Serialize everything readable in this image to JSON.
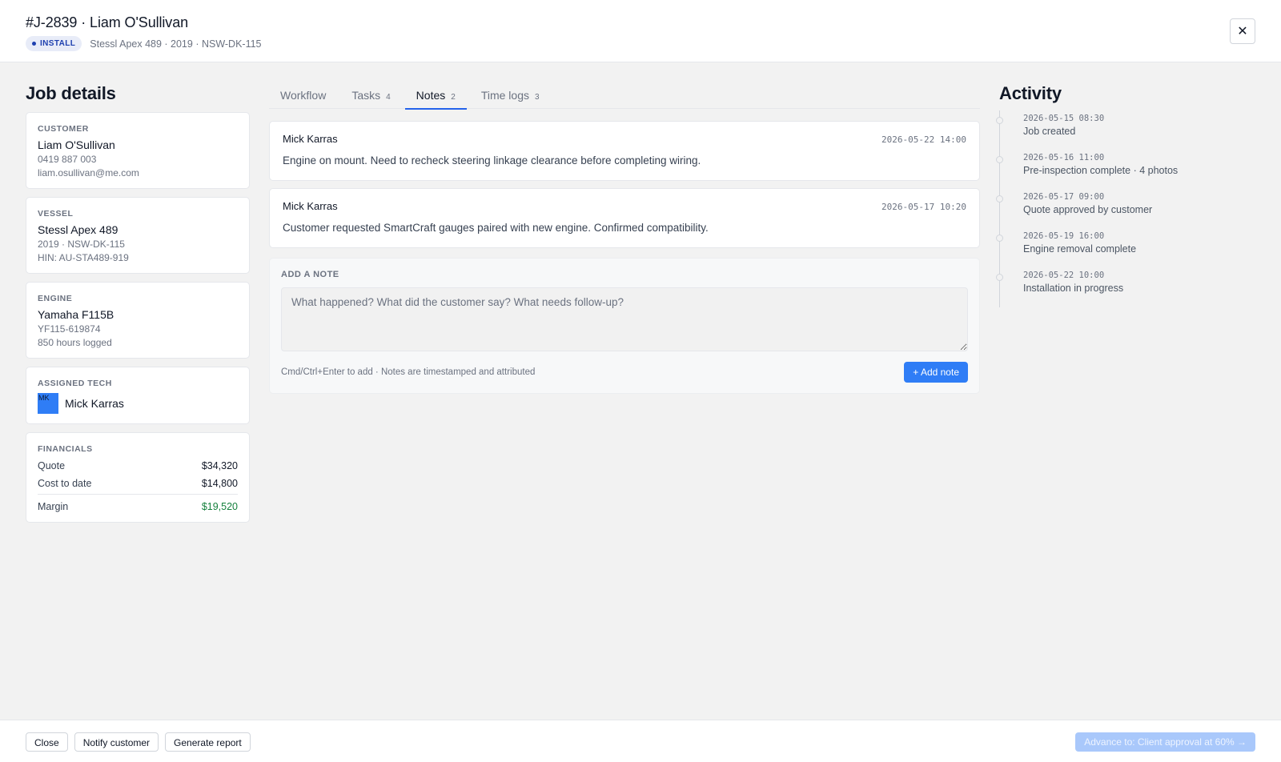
{
  "header": {
    "title": "#J-2839 · Liam O'Sullivan",
    "badge": "INSTALL",
    "meta": "Stessl Apex 489 · 2019 · NSW-DK-115",
    "close_icon": "✕"
  },
  "left": {
    "title": "Job details",
    "customer": {
      "label": "CUSTOMER",
      "name": "Liam O'Sullivan",
      "phone": "0419 887 003",
      "email": "liam.osullivan@me.com"
    },
    "vessel": {
      "label": "VESSEL",
      "name": "Stessl Apex 489",
      "detail": "2019 · NSW-DK-115",
      "hin": "HIN: AU-STA489-919"
    },
    "engine": {
      "label": "ENGINE",
      "name": "Yamaha F115B",
      "serial": "YF115-619874",
      "hours": "850 hours logged"
    },
    "tech": {
      "label": "ASSIGNED TECH",
      "initials": "MK",
      "name": "Mick Karras",
      "avatar_color": "#2f7df6"
    },
    "financials": {
      "label": "FINANCIALS",
      "quote_label": "Quote",
      "quote_value": "$34,320",
      "cost_label": "Cost to date",
      "cost_value": "$14,800",
      "margin_label": "Margin",
      "margin_value": "$19,520",
      "margin_color": "#15803d"
    }
  },
  "tabs": [
    {
      "label": "Workflow",
      "count": ""
    },
    {
      "label": "Tasks",
      "count": "4"
    },
    {
      "label": "Notes",
      "count": "2"
    },
    {
      "label": "Time logs",
      "count": "3"
    }
  ],
  "notes": [
    {
      "author": "Mick Karras",
      "time": "2026-05-22 14:00",
      "body": "Engine on mount. Need to recheck steering linkage clearance before completing wiring."
    },
    {
      "author": "Mick Karras",
      "time": "2026-05-17 10:20",
      "body": "Customer requested SmartCraft gauges paired with new engine. Confirmed compatibility."
    }
  ],
  "add_note": {
    "label": "ADD A NOTE",
    "placeholder": "What happened? What did the customer say? What needs follow-up?",
    "hint": "Cmd/Ctrl+Enter to add · Notes are timestamped and attributed",
    "button": "+ Add note",
    "accent": "#2f7df6"
  },
  "activity": {
    "title": "Activity",
    "items": [
      {
        "time": "2026-05-15 08:30",
        "text": "Job created"
      },
      {
        "time": "2026-05-16 11:00",
        "text": "Pre-inspection complete · 4 photos"
      },
      {
        "time": "2026-05-17 09:00",
        "text": "Quote approved by customer"
      },
      {
        "time": "2026-05-19 16:00",
        "text": "Engine removal complete"
      },
      {
        "time": "2026-05-22 10:00",
        "text": "Installation in progress"
      }
    ]
  },
  "footer": {
    "close": "Close",
    "notify": "Notify customer",
    "report": "Generate report",
    "advance": "Advance to: Client approval at 60% →"
  }
}
